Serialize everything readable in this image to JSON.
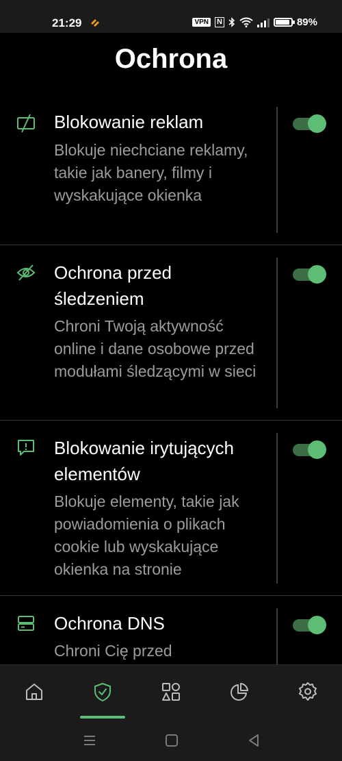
{
  "status_bar": {
    "time": "21:29",
    "vpn": "VPN",
    "nfc": "N",
    "battery_text": "89%",
    "battery_level": 0.89
  },
  "page": {
    "title": "Ochrona"
  },
  "items": [
    {
      "title": "Blokowanie reklam",
      "description": "Blokuje niechciane reklamy, takie jak banery, filmy i wyskakujące okienka",
      "enabled": true,
      "icon": "ad-blocking-icon"
    },
    {
      "title": "Ochrona przed śledzeniem",
      "description": "Chroni Twoją aktywność online i dane osobowe przed modułami śledzącymi w sieci",
      "enabled": true,
      "icon": "tracking-protection-icon"
    },
    {
      "title": "Blokowanie irytujących elementów",
      "description": "Blokuje elementy, takie jak powiadomienia o plikach cookie lub wyskakujące okienka na stronie",
      "enabled": true,
      "icon": "annoyance-blocking-icon"
    },
    {
      "title": "Ochrona DNS",
      "description": "Chroni Cię przed",
      "enabled": true,
      "icon": "dns-icon"
    }
  ],
  "bottom_nav": {
    "items": [
      {
        "name": "home",
        "icon": "home-icon"
      },
      {
        "name": "protection",
        "icon": "shield-check-icon",
        "active": true
      },
      {
        "name": "apps",
        "icon": "apps-grid-icon"
      },
      {
        "name": "statistics",
        "icon": "pie-chart-icon"
      },
      {
        "name": "settings",
        "icon": "gear-icon"
      }
    ]
  },
  "colors": {
    "accent": "#5dbd74",
    "toggle_track": "#3c6e46",
    "background": "#000000",
    "bar_background": "#1b1b1b",
    "secondary_text": "#9c9c9c",
    "divider": "#3b3b3b"
  }
}
